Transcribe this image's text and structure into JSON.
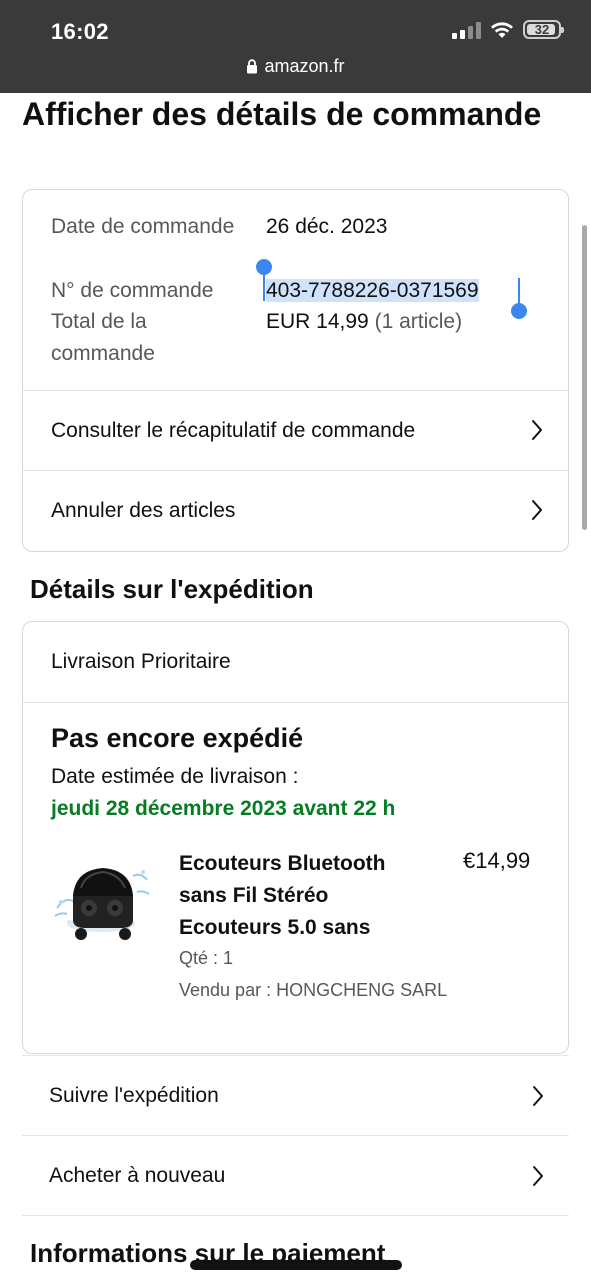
{
  "status_bar": {
    "time": "16:02",
    "battery": "32",
    "url": "amazon.fr"
  },
  "page": {
    "title": "Afficher des détails de commande"
  },
  "order": {
    "date_label": "Date de commande",
    "date_value": "26 déc. 2023",
    "number_label": "N° de commande",
    "number_value": "403-7788226-0371569",
    "total_label": "Total de la commande",
    "total_value": "EUR 14,99",
    "total_count": "(1 article)",
    "links": [
      {
        "label": "Consulter le récapitulatif de commande"
      },
      {
        "label": "Annuler des articles"
      }
    ]
  },
  "shipping": {
    "heading": "Détails sur l'expédition",
    "type": "Livraison Prioritaire",
    "status": "Pas encore expédié",
    "estimate_label": "Date estimée de livraison :",
    "estimate_date": "jeudi 28 décembre 2023 avant 22 h",
    "product": {
      "title": "Ecouteurs Bluetooth sans Fil Stéréo Ecouteurs 5.0 sans",
      "price": "€14,99",
      "qty": "Qté : 1",
      "seller": "Vendu par : HONGCHENG SARL"
    },
    "actions": [
      {
        "label": "Suivre l'expédition"
      },
      {
        "label": "Acheter à nouveau"
      }
    ]
  },
  "payment": {
    "heading": "Informations sur le paiement"
  },
  "colors": {
    "status_bar": "#3a3a3a",
    "green": "#067d24",
    "selection": "#cfe2fb",
    "handle": "#3d86f0",
    "border": "#d5d9d9"
  }
}
